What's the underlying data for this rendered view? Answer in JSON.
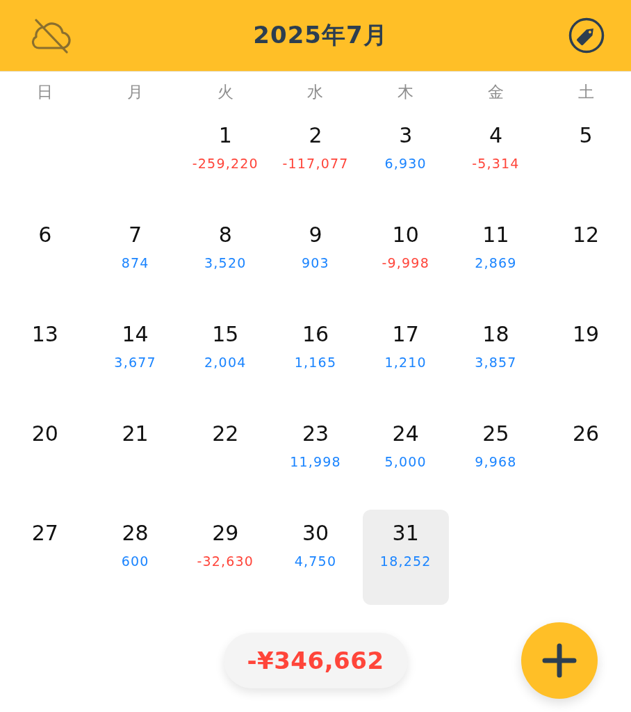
{
  "header": {
    "title": "2025年7月"
  },
  "weekdays": [
    "日",
    "月",
    "火",
    "水",
    "木",
    "金",
    "土"
  ],
  "weeks": [
    {
      "days": [
        {
          "day": "1",
          "amount": "-259,220",
          "color": "#ff453a",
          "selected": false
        },
        {
          "day": "2",
          "amount": "-117,077",
          "color": "#ff453a",
          "selected": false
        },
        {
          "day": "3",
          "amount": "6,930",
          "color": "#1a84ff",
          "selected": false
        },
        {
          "day": "4",
          "amount": "-5,314",
          "color": "#ff453a",
          "selected": false
        },
        {
          "day": "5",
          "selected": false
        }
      ]
    },
    {
      "days": [
        {
          "day": "6",
          "selected": false
        },
        {
          "day": "7",
          "amount": "874",
          "color": "#1a84ff",
          "selected": false
        },
        {
          "day": "8",
          "amount": "3,520",
          "color": "#1a84ff",
          "selected": false
        },
        {
          "day": "9",
          "amount": "903",
          "color": "#1a84ff",
          "selected": false
        },
        {
          "day": "10",
          "amount": "-9,998",
          "color": "#ff453a",
          "selected": false
        },
        {
          "day": "11",
          "amount": "2,869",
          "color": "#1a84ff",
          "selected": false
        },
        {
          "day": "12",
          "selected": false
        }
      ]
    },
    {
      "days": [
        {
          "day": "13",
          "selected": false
        },
        {
          "day": "14",
          "amount": "3,677",
          "color": "#1a84ff",
          "selected": false
        },
        {
          "day": "15",
          "amount": "2,004",
          "color": "#1a84ff",
          "selected": false
        },
        {
          "day": "16",
          "amount": "1,165",
          "color": "#1a84ff",
          "selected": false
        },
        {
          "day": "17",
          "amount": "1,210",
          "color": "#1a84ff",
          "selected": false
        },
        {
          "day": "18",
          "amount": "3,857",
          "color": "#1a84ff",
          "selected": false
        },
        {
          "day": "19",
          "selected": false
        }
      ]
    },
    {
      "days": [
        {
          "day": "20",
          "selected": false
        },
        {
          "day": "21",
          "selected": false
        },
        {
          "day": "22",
          "selected": false
        },
        {
          "day": "23",
          "amount": "11,998",
          "color": "#1a84ff",
          "selected": false
        },
        {
          "day": "24",
          "amount": "5,000",
          "color": "#1a84ff",
          "selected": false
        },
        {
          "day": "25",
          "amount": "9,968",
          "color": "#1a84ff",
          "selected": false
        },
        {
          "day": "26",
          "selected": false
        }
      ]
    },
    {
      "days": [
        {
          "day": "27",
          "selected": false
        },
        {
          "day": "28",
          "amount": "600",
          "color": "#1a84ff",
          "selected": false
        },
        {
          "day": "29",
          "amount": "-32,630",
          "color": "#ff453a",
          "selected": false
        },
        {
          "day": "30",
          "amount": "4,750",
          "color": "#1a84ff",
          "selected": false
        },
        {
          "day": "31",
          "amount": "18,252",
          "color": "#1a84ff",
          "selected": true
        }
      ]
    }
  ],
  "total": {
    "amount": "-¥346,662",
    "color": "#ff453a"
  }
}
